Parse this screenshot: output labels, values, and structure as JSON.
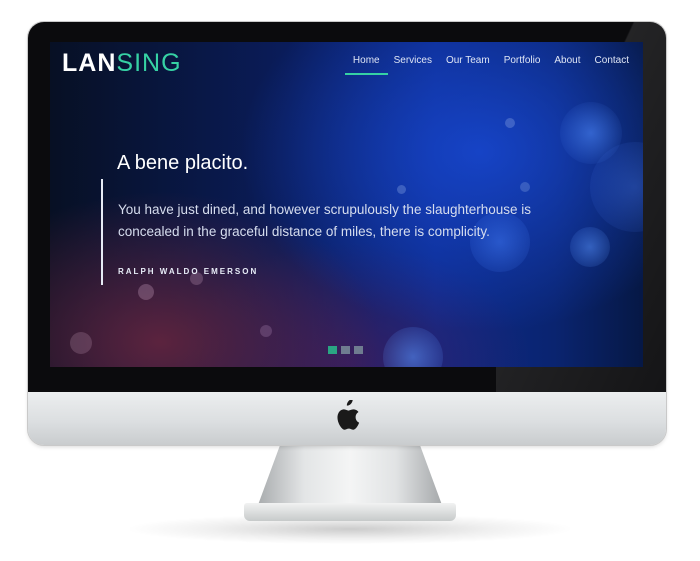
{
  "site": {
    "logo_bold": "LAN",
    "logo_light": "SING"
  },
  "nav": {
    "items": [
      {
        "label": "Home",
        "active": true
      },
      {
        "label": "Services",
        "active": false
      },
      {
        "label": "Our Team",
        "active": false
      },
      {
        "label": "Portfolio",
        "active": false
      },
      {
        "label": "About",
        "active": false
      },
      {
        "label": "Contact",
        "active": false
      }
    ]
  },
  "hero": {
    "title": "A bene placito.",
    "quote": "You have just dined, and however scrupulously the slaughterhouse is concealed in the graceful distance of miles, there is complicity.",
    "author": "RALPH WALDO EMERSON"
  },
  "slider": {
    "slides": 3,
    "active_index": 0
  },
  "colors": {
    "accent": "#36d1a4",
    "screen_bg": "#0c2a8a",
    "bezel": "#0b0b0d",
    "chin": "#dcdfe1"
  },
  "icons": {
    "chin_logo": "apple-logo-icon"
  }
}
